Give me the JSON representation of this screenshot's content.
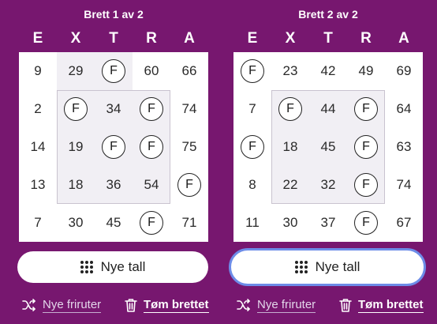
{
  "boards": [
    {
      "title": "Brett 1 av 2",
      "letters": [
        "E",
        "X",
        "T",
        "R",
        "A"
      ],
      "cells": [
        [
          "9",
          "29",
          "F",
          "60",
          "66"
        ],
        [
          "2",
          "F",
          "34",
          "F",
          "74"
        ],
        [
          "14",
          "19",
          "F",
          "F",
          "75"
        ],
        [
          "13",
          "18",
          "36",
          "54",
          "F"
        ],
        [
          "7",
          "30",
          "45",
          "F",
          "71"
        ]
      ],
      "new_numbers_label": "Nye tall",
      "new_free_label": "Nye friruter",
      "clear_label": "Tøm brettet"
    },
    {
      "title": "Brett 2 av 2",
      "letters": [
        "E",
        "X",
        "T",
        "R",
        "A"
      ],
      "cells": [
        [
          "F",
          "23",
          "42",
          "49",
          "69"
        ],
        [
          "7",
          "F",
          "44",
          "F",
          "64"
        ],
        [
          "F",
          "18",
          "45",
          "F",
          "63"
        ],
        [
          "8",
          "22",
          "32",
          "F",
          "74"
        ],
        [
          "11",
          "30",
          "37",
          "F",
          "67"
        ]
      ],
      "new_numbers_label": "Nye tall",
      "new_free_label": "Nye friruter",
      "clear_label": "Tøm brettet"
    }
  ],
  "free_marker": "F",
  "icons": {
    "new_numbers": "dots-grid-icon",
    "new_free": "shuffle-icon",
    "clear": "trash-icon"
  },
  "colors": {
    "background": "#77176f",
    "card": "#ffffff",
    "shaded": "#f1eff4",
    "focus_ring": "#6d8ce8"
  }
}
